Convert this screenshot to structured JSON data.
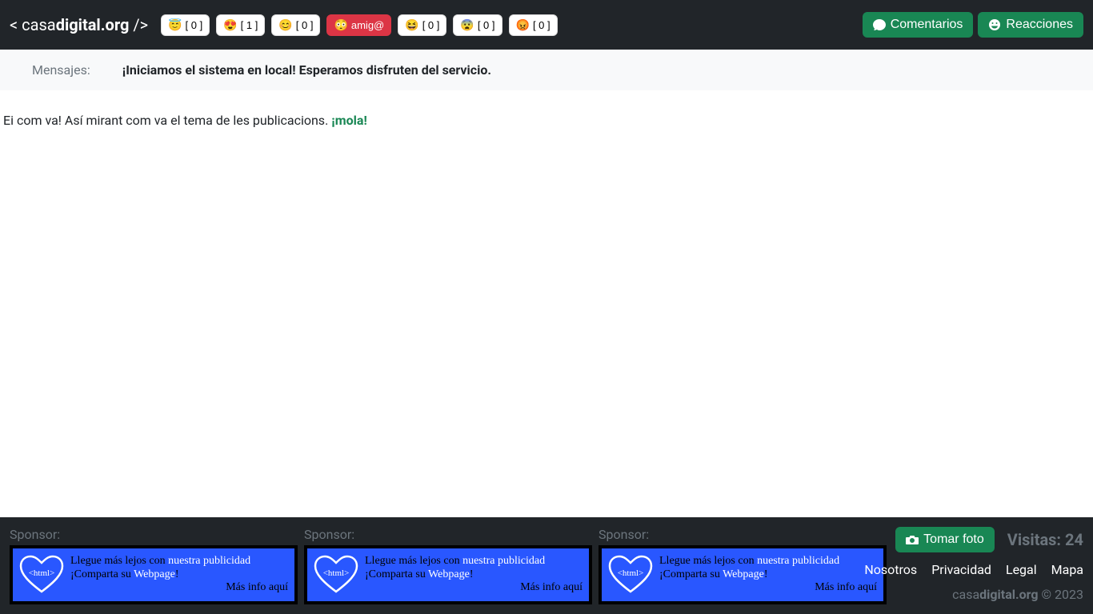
{
  "brand": {
    "prefix": "< casa",
    "bold": "digital.org",
    "suffix": " />"
  },
  "reactions": {
    "r0": {
      "emoji": "😇",
      "count": "[ 0 ]",
      "label": ""
    },
    "r1": {
      "emoji": "😍",
      "count": "[ 1 ]",
      "label": ""
    },
    "r2": {
      "emoji": "😊",
      "count": "[ 0 ]",
      "label": ""
    },
    "r3": {
      "emoji": "😳",
      "count": "",
      "label": "amig@"
    },
    "r4": {
      "emoji": "😆",
      "count": "[ 0 ]",
      "label": ""
    },
    "r5": {
      "emoji": "😨",
      "count": "[ 0 ]",
      "label": ""
    },
    "r6": {
      "emoji": "😡",
      "count": "[ 0 ]",
      "label": ""
    }
  },
  "nav": {
    "comentarios": "Comentarios",
    "reacciones": "Reacciones"
  },
  "messages": {
    "label": "Mensajes:",
    "text": "¡Iniciamos el sistema en local! Esperamos disfruten del servicio."
  },
  "content": {
    "text": "Ei com va! Así mirant com va el tema de les publicacions. ",
    "mola": "¡mola!"
  },
  "footer": {
    "sponsor_label": "Sponsor:",
    "banner": {
      "line1a": "Llegue más lejos con ",
      "line1b": "nuestra publicidad",
      "line2a": "¡Comparta su ",
      "line2b": "Webpage",
      "line2c": "!",
      "line3": "Más info aquí",
      "logo_text": "<html>"
    },
    "tomar_foto": "Tomar foto",
    "visitas_label": "Visitas: ",
    "visitas_count": "24",
    "links": {
      "nosotros": "Nosotros",
      "privacidad": "Privacidad",
      "legal": "Legal",
      "mapa": "Mapa"
    },
    "copyright_a": "casa",
    "copyright_b": "digital.org",
    "copyright_c": " © 2023"
  }
}
